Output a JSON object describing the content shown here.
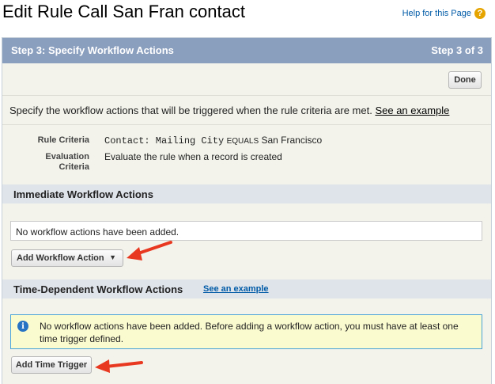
{
  "page": {
    "title": "Edit Rule Call San Fran contact",
    "help_link": "Help for this Page",
    "help_icon": "question-icon"
  },
  "step": {
    "title": "Step 3: Specify Workflow Actions",
    "counter": "Step 3 of 3",
    "done_label": "Done"
  },
  "instructions": {
    "text": "Specify the workflow actions that will be triggered when the rule criteria are met.",
    "link": "See an example"
  },
  "rule": {
    "criteria_label": "Rule Criteria",
    "criteria_field": "Contact: Mailing City",
    "criteria_operator": "EQUALS",
    "criteria_value": "San Francisco",
    "evaluation_label_1": "Evaluation",
    "evaluation_label_2": "Criteria",
    "evaluation_value": "Evaluate the rule when a record is created"
  },
  "immediate": {
    "title": "Immediate Workflow Actions",
    "empty_text": "No workflow actions have been added.",
    "add_label": "Add Workflow Action",
    "caret": "▼"
  },
  "time_dependent": {
    "title": "Time-Dependent Workflow Actions",
    "link": "See an example",
    "info_text": "No workflow actions have been added. Before adding a workflow action, you must have at least one time trigger defined.",
    "info_icon": "i",
    "add_label": "Add Time Trigger"
  },
  "colors": {
    "header": "#8a9ebe",
    "section": "#dfe3ea",
    "arrow": "#e8381f",
    "info_border": "#49a3d8",
    "info_bg": "#fbfbd0"
  }
}
